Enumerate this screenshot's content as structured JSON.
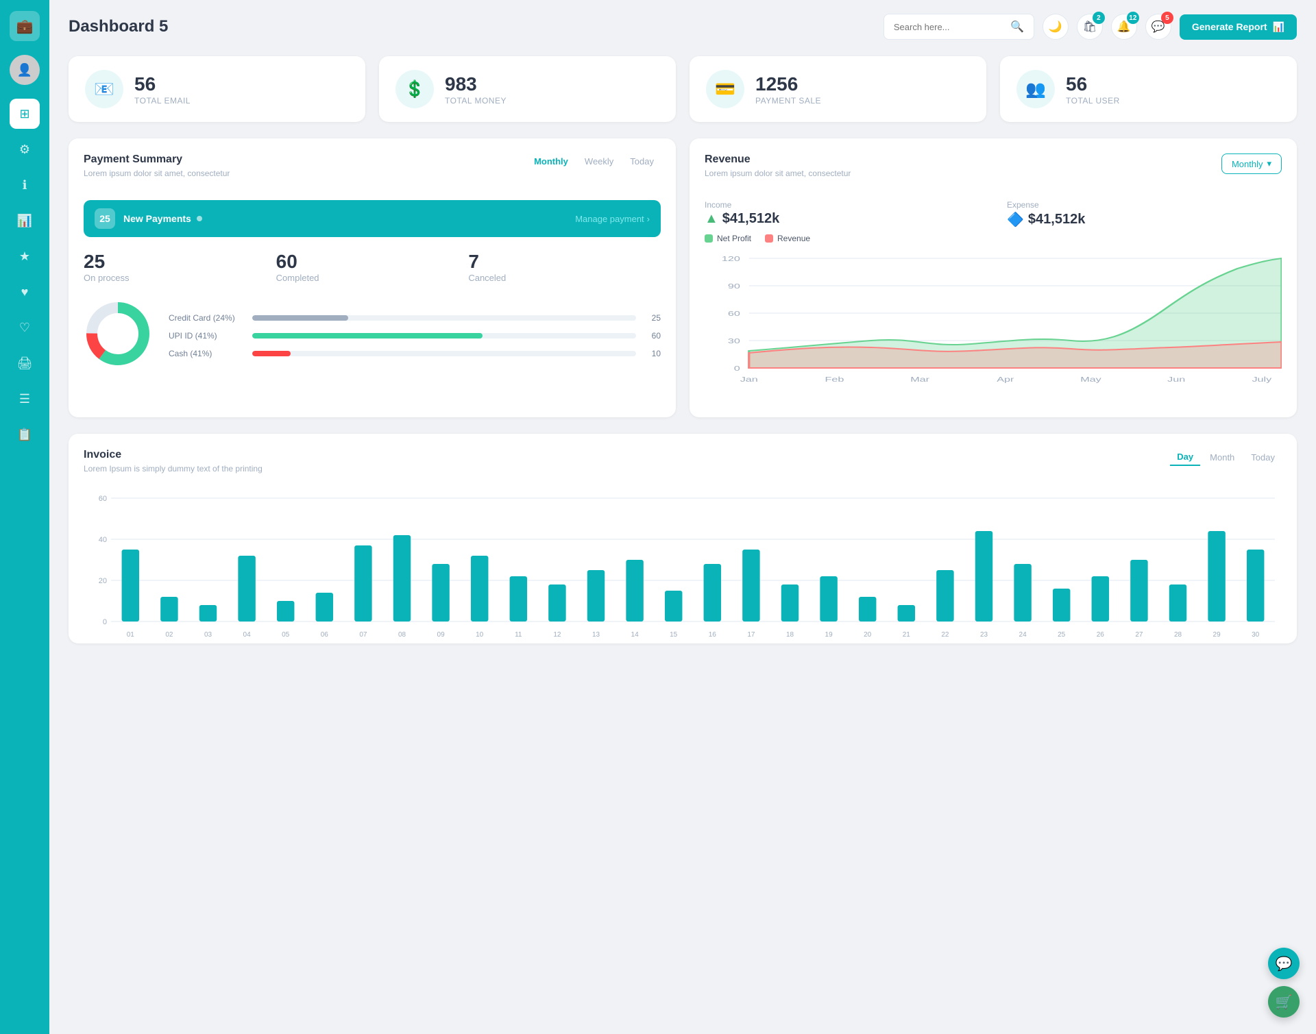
{
  "sidebar": {
    "logo_icon": "💼",
    "items": [
      {
        "id": "avatar",
        "icon": "👤",
        "active": false
      },
      {
        "id": "dashboard",
        "icon": "⊞",
        "active": true
      },
      {
        "id": "settings",
        "icon": "⚙",
        "active": false
      },
      {
        "id": "info",
        "icon": "ℹ",
        "active": false
      },
      {
        "id": "chart",
        "icon": "📊",
        "active": false
      },
      {
        "id": "star",
        "icon": "★",
        "active": false
      },
      {
        "id": "heart1",
        "icon": "♥",
        "active": false
      },
      {
        "id": "heart2",
        "icon": "♡",
        "active": false
      },
      {
        "id": "print",
        "icon": "🖨",
        "active": false
      },
      {
        "id": "menu",
        "icon": "☰",
        "active": false
      },
      {
        "id": "list",
        "icon": "📋",
        "active": false
      }
    ]
  },
  "header": {
    "title": "Dashboard 5",
    "search_placeholder": "Search here...",
    "notifications": [
      {
        "icon": "🛍",
        "count": 2,
        "badge_color": "teal"
      },
      {
        "icon": "🔔",
        "count": 12,
        "badge_color": "teal"
      },
      {
        "icon": "💬",
        "count": 5,
        "badge_color": "teal"
      }
    ],
    "generate_btn": "Generate Report"
  },
  "stats": [
    {
      "icon": "📧",
      "number": "56",
      "label": "TOTAL EMAIL"
    },
    {
      "icon": "💲",
      "number": "983",
      "label": "TOTAL MONEY"
    },
    {
      "icon": "💳",
      "number": "1256",
      "label": "PAYMENT SALE"
    },
    {
      "icon": "👥",
      "number": "56",
      "label": "TOTAL USER"
    }
  ],
  "payment_summary": {
    "title": "Payment Summary",
    "subtitle": "Lorem ipsum dolor sit amet, consectetur",
    "tabs": [
      "Monthly",
      "Weekly",
      "Today"
    ],
    "active_tab": "Monthly",
    "new_payments_count": "25",
    "new_payments_label": "New Payments",
    "manage_link": "Manage payment",
    "stats": [
      {
        "number": "25",
        "label": "On process"
      },
      {
        "number": "60",
        "label": "Completed"
      },
      {
        "number": "7",
        "label": "Canceled"
      }
    ],
    "progress_bars": [
      {
        "label": "Credit Card (24%)",
        "value": 25,
        "color": "#a0aec0",
        "count": 25
      },
      {
        "label": "UPI ID (41%)",
        "value": 60,
        "color": "#38d39f",
        "count": 60
      },
      {
        "label": "Cash (41%)",
        "value": 10,
        "color": "#fc4444",
        "count": 10
      }
    ],
    "donut": {
      "segments": [
        {
          "color": "#38d39f",
          "pct": 60
        },
        {
          "color": "#fc4444",
          "pct": 15
        },
        {
          "color": "#e2e8f0",
          "pct": 25
        }
      ]
    }
  },
  "revenue": {
    "title": "Revenue",
    "subtitle": "Lorem ipsum dolor sit amet, consectetur",
    "tab_label": "Monthly",
    "income_label": "Income",
    "income_value": "$41,512k",
    "expense_label": "Expense",
    "expense_value": "$41,512k",
    "legend": [
      {
        "label": "Net Profit",
        "color": "#68d391"
      },
      {
        "label": "Revenue",
        "color": "#fc8282"
      }
    ],
    "chart_months": [
      "Jan",
      "Feb",
      "Mar",
      "Apr",
      "May",
      "Jun",
      "July"
    ],
    "chart_y": [
      "120",
      "90",
      "60",
      "30",
      "0"
    ]
  },
  "invoice": {
    "title": "Invoice",
    "subtitle": "Lorem Ipsum is simply dummy text of the printing",
    "tabs": [
      "Day",
      "Month",
      "Today"
    ],
    "active_tab": "Day",
    "y_labels": [
      "60",
      "40",
      "20",
      "0"
    ],
    "x_labels": [
      "01",
      "02",
      "03",
      "04",
      "05",
      "06",
      "07",
      "08",
      "09",
      "10",
      "11",
      "12",
      "13",
      "14",
      "15",
      "16",
      "17",
      "18",
      "19",
      "20",
      "21",
      "22",
      "23",
      "24",
      "25",
      "26",
      "27",
      "28",
      "29",
      "30"
    ],
    "bar_data": [
      35,
      12,
      8,
      32,
      10,
      14,
      37,
      42,
      28,
      32,
      22,
      18,
      25,
      30,
      15,
      28,
      35,
      18,
      22,
      12,
      8,
      25,
      44,
      28,
      16,
      22,
      30,
      18,
      44,
      35
    ]
  },
  "fabs": [
    {
      "icon": "💬",
      "color": "#0ab3b8"
    },
    {
      "icon": "🛒",
      "color": "#38a169"
    }
  ]
}
